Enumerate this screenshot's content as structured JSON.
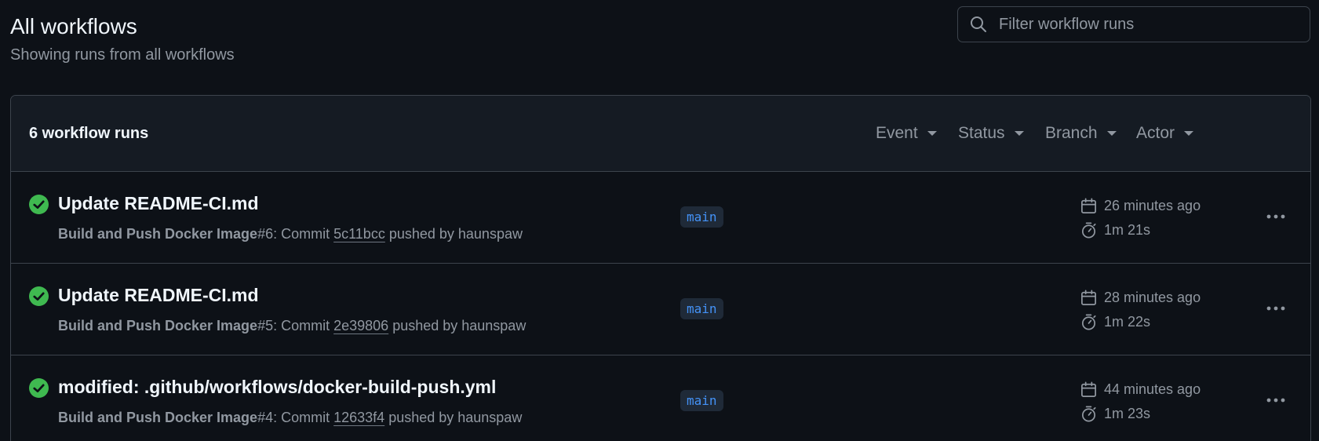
{
  "header": {
    "title": "All workflows",
    "subtitle": "Showing runs from all workflows"
  },
  "search": {
    "placeholder": "Filter workflow runs",
    "icon": "search-icon"
  },
  "runs_header": {
    "count_label": "6 workflow runs",
    "filters": [
      "Event",
      "Status",
      "Branch",
      "Actor"
    ]
  },
  "runs": [
    {
      "title": "Update README-CI.md",
      "workflow": "Build and Push Docker Image",
      "run_number": "#6",
      "commit_prefix": ": Commit ",
      "commit_sha": "5c11bcc",
      "pushed_by": " pushed by haunspaw",
      "branch": "main",
      "time_ago": "26 minutes ago",
      "duration": "1m 21s",
      "status": "success"
    },
    {
      "title": "Update README-CI.md",
      "workflow": "Build and Push Docker Image",
      "run_number": "#5",
      "commit_prefix": ": Commit ",
      "commit_sha": "2e39806",
      "pushed_by": " pushed by haunspaw",
      "branch": "main",
      "time_ago": "28 minutes ago",
      "duration": "1m 22s",
      "status": "success"
    },
    {
      "title": "modified: .github/workflows/docker-build-push.yml",
      "workflow": "Build and Push Docker Image",
      "run_number": "#4",
      "commit_prefix": ": Commit ",
      "commit_sha": "12633f4",
      "pushed_by": " pushed by haunspaw",
      "branch": "main",
      "time_ago": "44 minutes ago",
      "duration": "1m 23s",
      "status": "success"
    }
  ],
  "colors": {
    "background": "#0d1117",
    "success": "#3fb950",
    "branch_text": "#4493f8",
    "muted_text": "#9198a1",
    "border": "#3d444d"
  }
}
